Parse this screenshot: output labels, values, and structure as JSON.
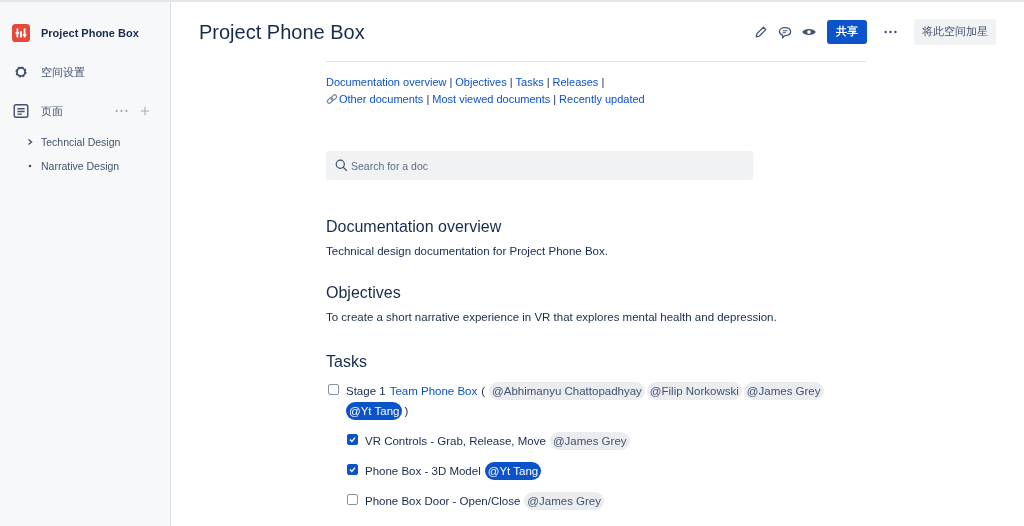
{
  "sidebar": {
    "space_name": "Project Phone Box",
    "settings": "空间设置",
    "pages_label": "页面",
    "pages": [
      {
        "label": "Techncial Design",
        "kind": "folder"
      },
      {
        "label": "Narrative Design",
        "kind": "leaf"
      }
    ]
  },
  "header": {
    "title": "Project Phone Box",
    "share": "共享",
    "star": "将此空间加星"
  },
  "nav": {
    "separator": "|",
    "links": [
      {
        "label": "Documentation overview",
        "kind": "plain"
      },
      {
        "label": "Objectives",
        "kind": "plain"
      },
      {
        "label": "Tasks",
        "kind": "plain"
      },
      {
        "label": "Releases",
        "kind": "plain"
      },
      {
        "label": "Other documents",
        "kind": "chain"
      },
      {
        "label": "Most viewed documents",
        "kind": "plain"
      },
      {
        "label": "Recently updated",
        "kind": "plain"
      }
    ]
  },
  "search": {
    "placeholder": "Search for a doc"
  },
  "sections": [
    {
      "heading": "Documentation overview",
      "text": "Technical design documentation for Project Phone Box."
    },
    {
      "heading": "Objectives",
      "text": "To create a short narrative experience in VR that explores mental health and depression."
    }
  ],
  "tasks_heading": "Tasks",
  "tasks": [
    {
      "checked": false,
      "segments": [
        {
          "kind": "text",
          "text": "Stage 1"
        },
        {
          "kind": "link",
          "text": "Team Phone Box"
        },
        {
          "kind": "text",
          "text": "("
        },
        {
          "kind": "mention",
          "text": "@Abhimanyu Chattopadhyay",
          "highlighted": false
        },
        {
          "kind": "mention",
          "text": "@Filip Norkowski",
          "highlighted": false
        },
        {
          "kind": "mention",
          "text": "@James Grey",
          "highlighted": false
        },
        {
          "kind": "mention",
          "text": "@Yt Tang",
          "highlighted": true
        },
        {
          "kind": "text",
          "text": ")"
        }
      ],
      "children": [
        {
          "checked": true,
          "segments": [
            {
              "kind": "text",
              "text": "VR Controls - Grab, Release, Move"
            },
            {
              "kind": "mention",
              "text": "@James Grey",
              "highlighted": false
            }
          ]
        },
        {
          "checked": true,
          "segments": [
            {
              "kind": "text",
              "text": "Phone Box - 3D Model"
            },
            {
              "kind": "mention",
              "text": "@Yt Tang",
              "highlighted": true
            }
          ]
        },
        {
          "checked": false,
          "segments": [
            {
              "kind": "text",
              "text": "Phone Box Door - Open/Close"
            },
            {
              "kind": "mention",
              "text": "@James Grey",
              "highlighted": false
            }
          ]
        }
      ]
    }
  ]
}
